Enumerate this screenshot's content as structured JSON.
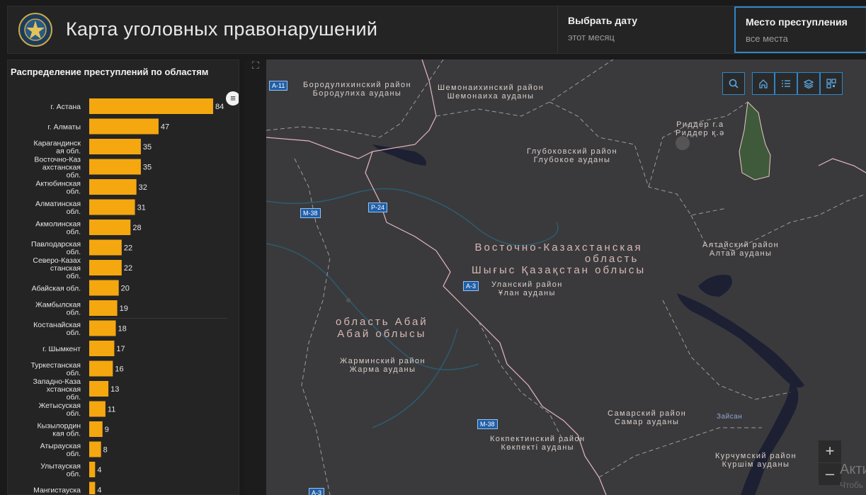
{
  "header": {
    "title": "Карта уголовных правонарушений",
    "date_selector": {
      "label": "Выбрать дату",
      "value": "этот месяц"
    },
    "place_selector": {
      "label": "Место преступления",
      "value": "все места"
    }
  },
  "panel": {
    "title": "Распределение преступлений по областям",
    "menu_glyph": "≡"
  },
  "chart_data": {
    "type": "bar",
    "orientation": "horizontal",
    "title": "Распределение преступлений по областям",
    "categories": [
      [
        "г. Астана"
      ],
      [
        "г. Алматы"
      ],
      [
        "Карагандинск",
        "ая обл."
      ],
      [
        "Восточно-Каз",
        "ахстанская",
        "обл."
      ],
      [
        "Актюбинская",
        "обл."
      ],
      [
        "Алматинская",
        "обл."
      ],
      [
        "Акмолинская",
        "обл."
      ],
      [
        "Павлодарская",
        "обл."
      ],
      [
        "Северо-Казах",
        "станская",
        "обл."
      ],
      [
        "Абайская обл."
      ],
      [
        "Жамбылская",
        "обл."
      ],
      [
        "Костанайская",
        "обл."
      ],
      [
        "г. Шымкент"
      ],
      [
        "Туркестанская",
        "обл."
      ],
      [
        "Западно-Каза",
        "хстанская",
        "обл."
      ],
      [
        "Жетысуская",
        "обл."
      ],
      [
        "Кызылордин",
        "кая обл."
      ],
      [
        "Атырауская",
        "обл."
      ],
      [
        "Улытауская",
        "обл."
      ],
      [
        "Мангистауска"
      ]
    ],
    "values": [
      84,
      47,
      35,
      35,
      32,
      31,
      28,
      22,
      22,
      20,
      19,
      18,
      17,
      16,
      13,
      11,
      9,
      8,
      4,
      4
    ],
    "bar_color": "#f5a70f"
  },
  "map": {
    "labels": [
      {
        "id": "borod",
        "lines": [
          "Бородулихинский район",
          "Бородулиха ауданы"
        ]
      },
      {
        "id": "shemon",
        "lines": [
          "Шемонаихинский район",
          "Шемонаиха ауданы"
        ]
      },
      {
        "id": "ridder",
        "lines": [
          "Риддер г.а",
          "Риддер қ.ә"
        ]
      },
      {
        "id": "glub",
        "lines": [
          "Глубоковский район",
          "Глубокое ауданы"
        ]
      },
      {
        "id": "vko",
        "lines": [
          "Восточно-Казахстанская",
          "область",
          "Шығыс Қазақстан облысы"
        ]
      },
      {
        "id": "altai",
        "lines": [
          "Алтайский район",
          "Алтай ауданы"
        ]
      },
      {
        "id": "ulan",
        "lines": [
          "Уланский район",
          "Ұлан ауданы"
        ]
      },
      {
        "id": "abai",
        "lines": [
          "область Абай",
          "Абай облысы"
        ]
      },
      {
        "id": "zharma",
        "lines": [
          "Жарминский район",
          "Жарма ауданы"
        ]
      },
      {
        "id": "samar",
        "lines": [
          "Самарский район",
          "Самар ауданы"
        ]
      },
      {
        "id": "kokpek",
        "lines": [
          "Кокпектинский район",
          "Көкпекті ауданы"
        ]
      },
      {
        "id": "kurchum",
        "lines": [
          "Курчумский район",
          "Күршім ауданы"
        ]
      },
      {
        "id": "zaisan",
        "lines": [
          "Зайсан"
        ]
      }
    ],
    "roads": [
      "А-11",
      "М-38",
      "Р-24",
      "А-3",
      "М-38",
      "А-3"
    ],
    "zoom_in": "+",
    "zoom_out": "–",
    "watermark": "Акти",
    "watermark_sub": "Чтобь"
  }
}
